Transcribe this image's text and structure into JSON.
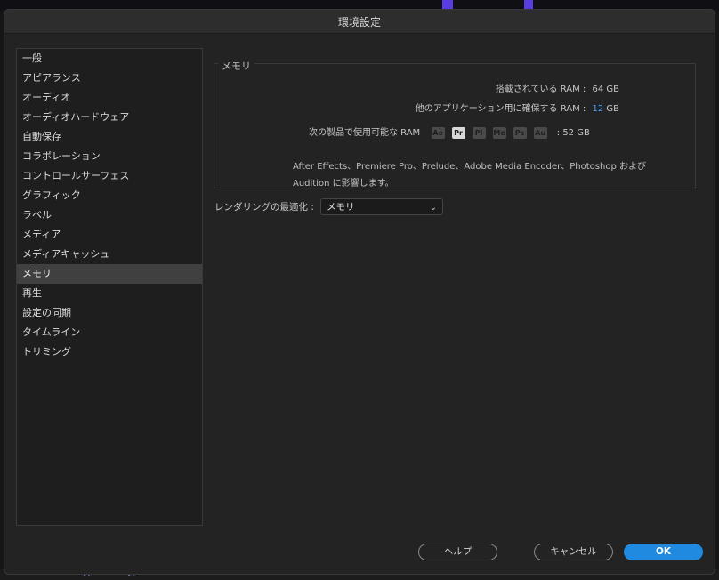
{
  "dialog": {
    "title": "環境設定"
  },
  "sidebar": {
    "items": [
      {
        "label": "一般"
      },
      {
        "label": "アピアランス"
      },
      {
        "label": "オーディオ"
      },
      {
        "label": "オーディオハードウェア"
      },
      {
        "label": "自動保存"
      },
      {
        "label": "コラボレーション"
      },
      {
        "label": "コントロールサーフェス"
      },
      {
        "label": "グラフィック"
      },
      {
        "label": "ラベル"
      },
      {
        "label": "メディア"
      },
      {
        "label": "メディアキャッシュ"
      },
      {
        "label": "メモリ",
        "selected": true
      },
      {
        "label": "再生"
      },
      {
        "label": "設定の同期"
      },
      {
        "label": "タイムライン"
      },
      {
        "label": "トリミング"
      }
    ]
  },
  "memory": {
    "group_title": "メモリ",
    "installed_label": "搭載されている RAM :",
    "installed_value": "64 GB",
    "reserved_label": "他のアプリケーション用に確保する RAM :",
    "reserved_value": "12",
    "reserved_unit": "GB",
    "available_label": "次の製品で使用可能な RAM",
    "apps": [
      "Ae",
      "Pr",
      "Pl",
      "Me",
      "Ps",
      "Au"
    ],
    "active_app": "Pr",
    "available_value": ":   52 GB",
    "note_line1": "After Effects、Premiere Pro、Prelude、Adobe Media Encoder、Photoshop および",
    "note_line2": "Audition に影響します。"
  },
  "rendering": {
    "label": "レンダリングの最適化 :",
    "selected": "メモリ"
  },
  "buttons": {
    "help": "ヘルプ",
    "cancel": "キャンセル",
    "ok": "OK"
  },
  "background": {
    "tags": [
      "V2",
      "V2"
    ]
  },
  "colors": {
    "accent": "#1f8ae0",
    "reserved_value": "#4aa3ff"
  }
}
